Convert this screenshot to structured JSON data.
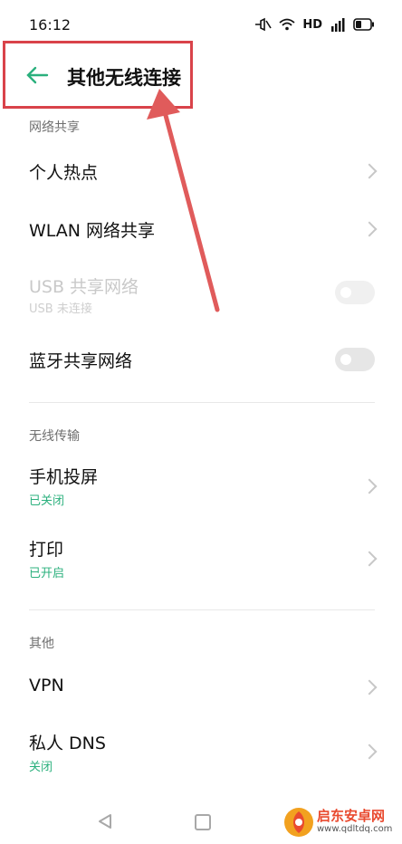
{
  "status_bar": {
    "time": "16:12",
    "hd_label": "HD",
    "icons": [
      "signal-muted-icon",
      "wifi-icon",
      "hd-badge",
      "cellular-4g-icon",
      "battery-icon"
    ]
  },
  "header": {
    "title": "其他无线连接",
    "back_icon": "back-arrow-icon",
    "accent_color": "#2bb07d"
  },
  "sections": {
    "network_sharing": {
      "header": "网络共享",
      "items": [
        {
          "title": "个人热点"
        },
        {
          "title": "WLAN 网络共享"
        },
        {
          "title": "USB 共享网络",
          "subtitle": "USB 未连接",
          "enabled": false,
          "toggle_on": false
        },
        {
          "title": "蓝牙共享网络",
          "toggle_on": false
        }
      ]
    },
    "wireless_transfer": {
      "header": "无线传输",
      "items": [
        {
          "title": "手机投屏",
          "subtitle": "已关闭"
        },
        {
          "title": "打印",
          "subtitle": "已开启"
        }
      ]
    },
    "other": {
      "header": "其他",
      "items": [
        {
          "title": "VPN"
        },
        {
          "title": "私人 DNS",
          "subtitle": "关闭"
        }
      ]
    }
  },
  "annotation": {
    "color": "#d9434a"
  },
  "watermark": {
    "brand": "启东安卓网",
    "url": "www.qdltdq.com"
  }
}
